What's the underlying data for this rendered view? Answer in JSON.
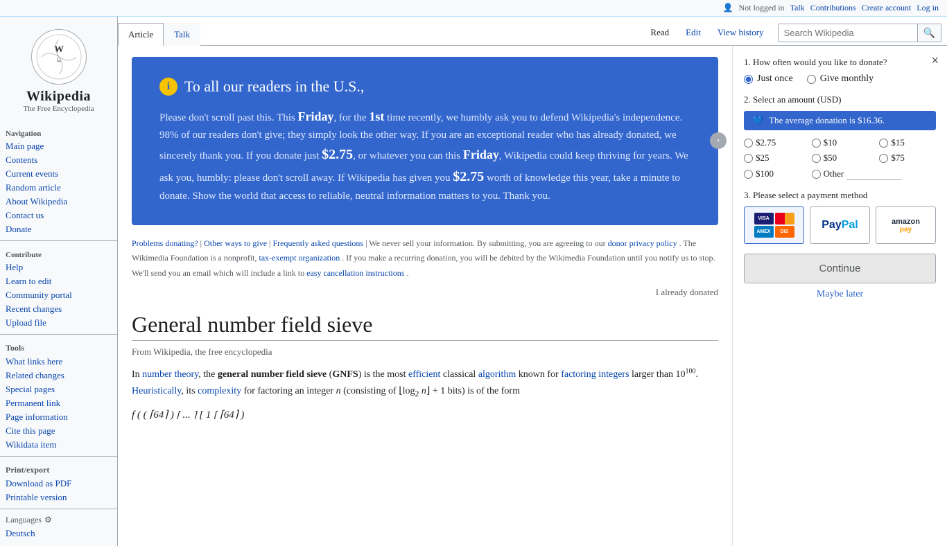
{
  "topbar": {
    "not_logged_in": "Not logged in",
    "talk": "Talk",
    "contributions": "Contributions",
    "create_account": "Create account",
    "log_in": "Log in"
  },
  "sidebar": {
    "logo_text": "Wikipedia",
    "logo_sub": "The Free Encyclopedia",
    "navigation": "Navigation",
    "items": [
      {
        "label": "Main page",
        "id": "main-page"
      },
      {
        "label": "Contents",
        "id": "contents"
      },
      {
        "label": "Current events",
        "id": "current-events"
      },
      {
        "label": "Random article",
        "id": "random-article"
      },
      {
        "label": "About Wikipedia",
        "id": "about-wikipedia"
      },
      {
        "label": "Contact us",
        "id": "contact-us"
      },
      {
        "label": "Donate",
        "id": "donate"
      }
    ],
    "contribute": "Contribute",
    "contribute_items": [
      {
        "label": "Help",
        "id": "help"
      },
      {
        "label": "Learn to edit",
        "id": "learn-to-edit"
      },
      {
        "label": "Community portal",
        "id": "community-portal"
      },
      {
        "label": "Recent changes",
        "id": "recent-changes"
      },
      {
        "label": "Upload file",
        "id": "upload-file"
      }
    ],
    "tools": "Tools",
    "tool_items": [
      {
        "label": "What links here",
        "id": "what-links-here"
      },
      {
        "label": "Related changes",
        "id": "related-changes"
      },
      {
        "label": "Special pages",
        "id": "special-pages"
      },
      {
        "label": "Permanent link",
        "id": "permanent-link"
      },
      {
        "label": "Page information",
        "id": "page-information"
      },
      {
        "label": "Cite this page",
        "id": "cite-this-page"
      },
      {
        "label": "Wikidata item",
        "id": "wikidata-item"
      }
    ],
    "print_export": "Print/export",
    "print_items": [
      {
        "label": "Download as PDF",
        "id": "download-pdf"
      },
      {
        "label": "Printable version",
        "id": "printable-version"
      }
    ],
    "languages": "Languages",
    "languages_items": [
      {
        "label": "Deutsch",
        "id": "deutsch"
      }
    ]
  },
  "tabs": {
    "article": "Article",
    "talk": "Talk",
    "read": "Read",
    "edit": "Edit",
    "view_history": "View history",
    "search_placeholder": "Search Wikipedia"
  },
  "donation_banner": {
    "info_icon": "i",
    "title": "To all our readers in the U.S.,",
    "body_1": "Please don’t scroll past this. This ",
    "friday1": "Friday",
    "body_2": ", for the ",
    "first": "1st",
    "body_3": " time recently, we humbly ask you to defend Wikipedia’s independence. 98% of our readers don’t give; they simply look the other way. If you are an exceptional reader who has already donated, we sincerely thank you. If you donate just ",
    "dollar1": "$2.75",
    "body_4": ", or whatever you can this ",
    "friday2": "Friday",
    "body_5": ", Wikipedia could keep thriving for years. We ask you, humbly: please don’t scroll away. If Wikipedia has given you ",
    "dollar2": "$2.75",
    "body_6": " worth of knowledge this year, take a minute to donate. Show the world that access to reliable, neutral information matters to you. Thank you."
  },
  "banner_footer": {
    "problems": "Problems donating?",
    "separator1": " | ",
    "other_ways": "Other ways to give",
    "separator2": " | ",
    "faq": "Frequently asked questions",
    "text1": " | We never sell your information. By submitting, you are agreeing to our ",
    "privacy_link": "donor privacy policy",
    "text2": ". The Wikimedia Foundation is a nonprofit, ",
    "tax_exempt": "tax-exempt organization",
    "text3": ". If you make a recurring donation, you will be debited by the Wikimedia Foundation until you notify us to stop. We'll send you an email which will include a link to ",
    "cancellation": "easy cancellation instructions",
    "text4": "."
  },
  "already_donated": "I already donated",
  "donation_panel": {
    "close_label": "×",
    "step1_label": "1.  How often would you like to donate?",
    "just_once": "Just once",
    "give_monthly": "Give monthly",
    "step2_label": "2.  Select an amount (USD)",
    "avg_text": "The average donation is $16.36.",
    "amounts": [
      "$2.75",
      "$10",
      "$15",
      "$25",
      "$50",
      "$75",
      "$100"
    ],
    "other_label": "Other",
    "step3_label": "3.  Please select a payment method",
    "payment_methods": [
      "card",
      "paypal",
      "amazon"
    ],
    "continue_label": "Continue",
    "maybe_later": "Maybe later"
  },
  "article": {
    "title": "General number field sieve",
    "subtitle": "From Wikipedia, the free encyclopedia",
    "intro": "In ",
    "number_theory": "number theory",
    "intro2": ", the ",
    "gnfs_full": "general number field sieve",
    "gnfs_abbr": "GNFS",
    "intro3": " is the most ",
    "efficient": "efficient",
    "intro4": " classical ",
    "algorithm": "algorithm",
    "intro5": " known for ",
    "factoring": "factoring integers",
    "intro6": " larger than 10",
    "exponent": "100",
    "intro7": ". ",
    "heuristically": "Heuristically",
    "intro8": ", its ",
    "complexity": "complexity",
    "intro9": " for factoring an integer ",
    "n_italic": "n",
    "intro10": " (consisting of ⌊log",
    "sub2": "2",
    "intro11": " n⌋ + 1 bits) is of the form"
  }
}
